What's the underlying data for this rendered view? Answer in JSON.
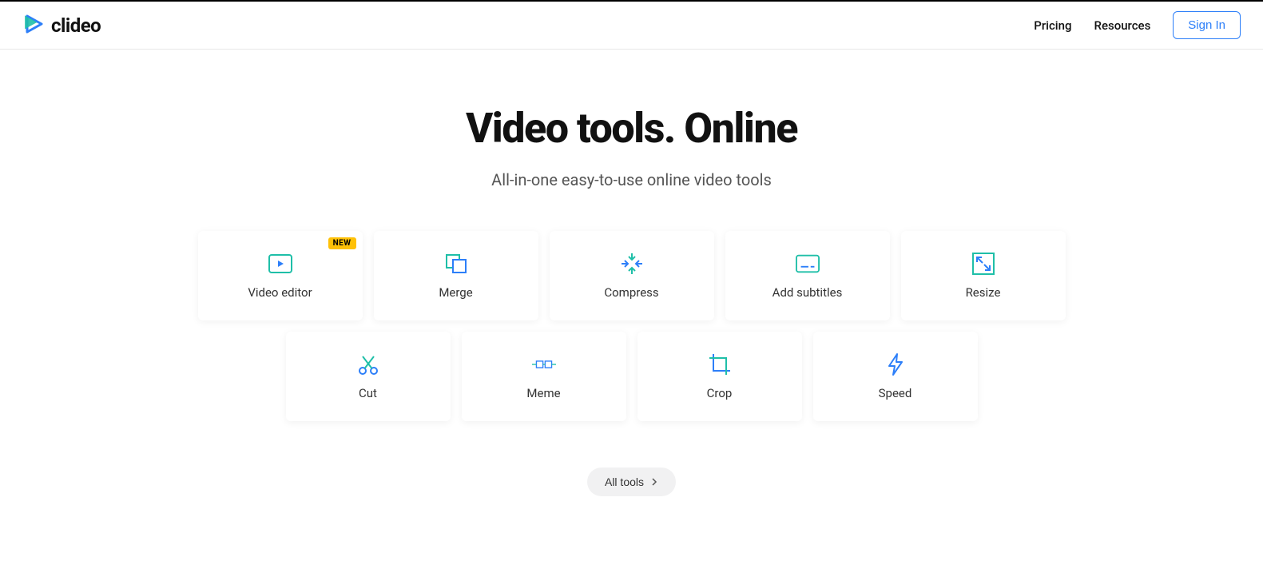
{
  "header": {
    "brand": "clideo",
    "nav": {
      "pricing": "Pricing",
      "resources": "Resources",
      "signin": "Sign In"
    }
  },
  "hero": {
    "title": "Video tools. Online",
    "subtitle": "All-in-one easy-to-use online video tools"
  },
  "tools": {
    "row1": [
      {
        "label": "Video editor",
        "icon": "play-icon",
        "badge": "NEW"
      },
      {
        "label": "Merge",
        "icon": "merge-icon"
      },
      {
        "label": "Compress",
        "icon": "compress-icon"
      },
      {
        "label": "Add subtitles",
        "icon": "subtitles-icon"
      },
      {
        "label": "Resize",
        "icon": "resize-icon"
      }
    ],
    "row2": [
      {
        "label": "Cut",
        "icon": "cut-icon"
      },
      {
        "label": "Meme",
        "icon": "meme-icon"
      },
      {
        "label": "Crop",
        "icon": "crop-icon"
      },
      {
        "label": "Speed",
        "icon": "speed-icon"
      }
    ]
  },
  "all_tools_label": "All tools",
  "colors": {
    "teal": "#1fbfa8",
    "blue": "#2d7ff9",
    "badge": "#ffc107"
  }
}
